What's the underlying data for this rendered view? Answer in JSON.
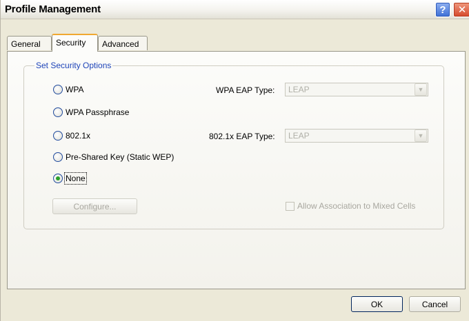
{
  "window": {
    "title": "Profile Management",
    "help_glyph": "?",
    "close_glyph": "✕"
  },
  "tabs": [
    {
      "label": "General",
      "selected": false
    },
    {
      "label": "Security",
      "selected": true
    },
    {
      "label": "Advanced",
      "selected": false
    }
  ],
  "group": {
    "label": "Set Security Options"
  },
  "options": [
    {
      "label": "WPA",
      "checked": false
    },
    {
      "label": "WPA Passphrase",
      "checked": false
    },
    {
      "label": "802.1x",
      "checked": false
    },
    {
      "label": "Pre-Shared Key (Static WEP)",
      "checked": false
    },
    {
      "label": "None",
      "checked": true
    }
  ],
  "wpa_eap": {
    "label": "WPA EAP Type:",
    "value": "LEAP",
    "enabled": false
  },
  "dot1x_eap": {
    "label": "802.1x EAP Type:",
    "value": "LEAP",
    "enabled": false
  },
  "configure_button": {
    "label": "Configure...",
    "enabled": false
  },
  "mixed_cells": {
    "label": "Allow Association to Mixed Cells",
    "checked": false,
    "enabled": false
  },
  "footer": {
    "ok_label": "OK",
    "cancel_label": "Cancel"
  },
  "colors": {
    "dialog_bg": "#ece9d8",
    "group_label": "#1e44b8",
    "selected_tab_accent": "#f0a830",
    "radio_dot": "#2aa12a",
    "close_button": "#d4472a",
    "help_button": "#3d6fd6"
  }
}
